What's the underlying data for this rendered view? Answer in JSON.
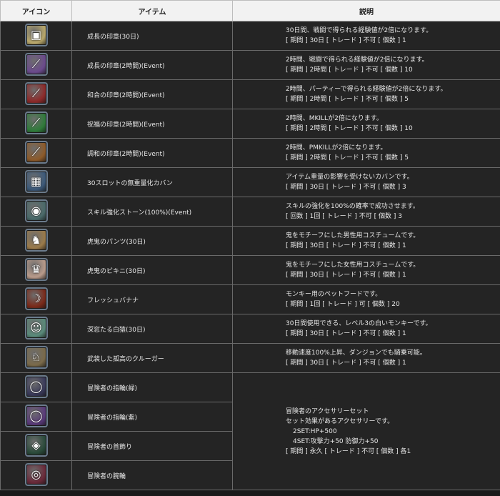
{
  "headers": {
    "icon": "アイコン",
    "item": "アイテム",
    "description": "説明"
  },
  "items": [
    {
      "icon_name": "seal-scroll-icon",
      "icon_color": "#b8a76b",
      "glyph": "▣",
      "name": "成長の印章(30日)",
      "desc": [
        "30日間、戦闘で得られる経験値が2倍になります。",
        "[ 期間 ] 30日 [ トレード ] 不可 [ 個数 ] 1"
      ]
    },
    {
      "icon_name": "purple-seal-icon",
      "icon_color": "#6b4a8c",
      "glyph": "⟋",
      "name": "成長の印章(2時間)(Event)",
      "desc": [
        "2時間、戦闘で得られる経験値が2倍になります。",
        "[ 期間 ] 2時間 [ トレード ] 不可 [ 個数 ] 10"
      ]
    },
    {
      "icon_name": "red-seal-icon",
      "icon_color": "#8c2a2a",
      "glyph": "⟋",
      "name": "和合の印章(2時間)(Event)",
      "desc": [
        "2時間、パーティーで得られる経験値が2倍になります。",
        "[ 期間 ] 2時間 [ トレード ] 不可 [ 個数 ] 5"
      ]
    },
    {
      "icon_name": "green-seal-icon",
      "icon_color": "#2f7a3a",
      "glyph": "⟋",
      "name": "祝福の印章(2時間)(Event)",
      "desc": [
        "2時間、MKILLが2倍になります。",
        "[ 期間 ] 2時間 [ トレード ] 不可 [ 個数 ] 10"
      ]
    },
    {
      "icon_name": "brown-seal-icon",
      "icon_color": "#8c5a2a",
      "glyph": "⟋",
      "name": "調和の印章(2時間)(Event)",
      "desc": [
        "2時間、PMKILLが2倍になります。",
        "[ 期間 ] 2時間 [ トレード ] 不可 [ 個数 ] 5"
      ]
    },
    {
      "icon_name": "bag-icon",
      "icon_color": "#3d5a7a",
      "glyph": "▦",
      "name": "30スロットの無重量化カバン",
      "desc": [
        "アイテム重量の影響を受けないカバンです。",
        "[ 期間 ] 30日 [ トレード ] 不可 [ 個数 ] 3"
      ]
    },
    {
      "icon_name": "enhance-stone-icon",
      "icon_color": "#4a6a6a",
      "glyph": "◉",
      "name": "スキル強化ストーン(100%)(Event)",
      "desc": [
        "スキルの強化を100%の確率で成功させます。",
        "[ 回数 ] 1回 [ トレード ] 不可 [ 個数 ] 3"
      ]
    },
    {
      "icon_name": "tiger-pants-icon",
      "icon_color": "#9a7a4a",
      "glyph": "♞",
      "name": "虎鬼のパンツ(30日)",
      "desc": [
        "鬼をモチーフにした男性用コスチュームです。",
        "[ 期間 ] 30日 [ トレード ] 不可 [ 個数 ] 1"
      ]
    },
    {
      "icon_name": "tiger-bikini-icon",
      "icon_color": "#b89a8a",
      "glyph": "♛",
      "name": "虎鬼のビキニ(30日)",
      "desc": [
        "鬼をモチーフにした女性用コスチュームです。",
        "[ 期間 ] 30日 [ トレード ] 不可 [ 個数 ] 1"
      ]
    },
    {
      "icon_name": "banana-icon",
      "icon_color": "#7a2a1a",
      "glyph": "☽",
      "name": "フレッシュバナナ",
      "desc": [
        "モンキー用のペットフードです。",
        "[ 期間 ] 1回 [ トレード ] 可 [ 個数 ] 20"
      ]
    },
    {
      "icon_name": "monkey-icon",
      "icon_color": "#5a8a7a",
      "glyph": "☺",
      "name": "深窓たる白猿(30日)",
      "desc": [
        "30日間使用できる、レベル3の白いモンキーです。",
        "[ 期間 ] 30日 [ トレード ] 不可 [ 個数 ] 1"
      ]
    },
    {
      "icon_name": "dragon-mount-icon",
      "icon_color": "#7a6a4a",
      "glyph": "♘",
      "name": "武装した孤高のクルーガー",
      "desc": [
        "移動速度100%上昇、ダンジョンでも騎乗可能。",
        "[ 期間 ] 30日 [ トレード ] 不可 [ 個数 ] 1"
      ]
    }
  ],
  "accessories": [
    {
      "icon_name": "ring-green-icon",
      "icon_color": "#3a3a5a",
      "glyph": "◯",
      "name": "冒険者の指輪(緑)"
    },
    {
      "icon_name": "ring-purple-icon",
      "icon_color": "#5a3a7a",
      "glyph": "◯",
      "name": "冒険者の指輪(紫)"
    },
    {
      "icon_name": "necklace-icon",
      "icon_color": "#2a4a3a",
      "glyph": "◈",
      "name": "冒険者の首飾り"
    },
    {
      "icon_name": "bracelet-icon",
      "icon_color": "#6a2a3a",
      "glyph": "◎",
      "name": "冒険者の腕輪"
    }
  ],
  "accessory_desc": {
    "title": "冒険者のアクセサリーセット",
    "subtitle": "セット効果があるアクセサリーです。",
    "set2": "2SET:HP+500",
    "set4": "4SET:攻撃力+50 防御力+50",
    "spec": "[ 期間 ] 永久 [ トレード ] 不可 [ 個数 ] 各1"
  }
}
